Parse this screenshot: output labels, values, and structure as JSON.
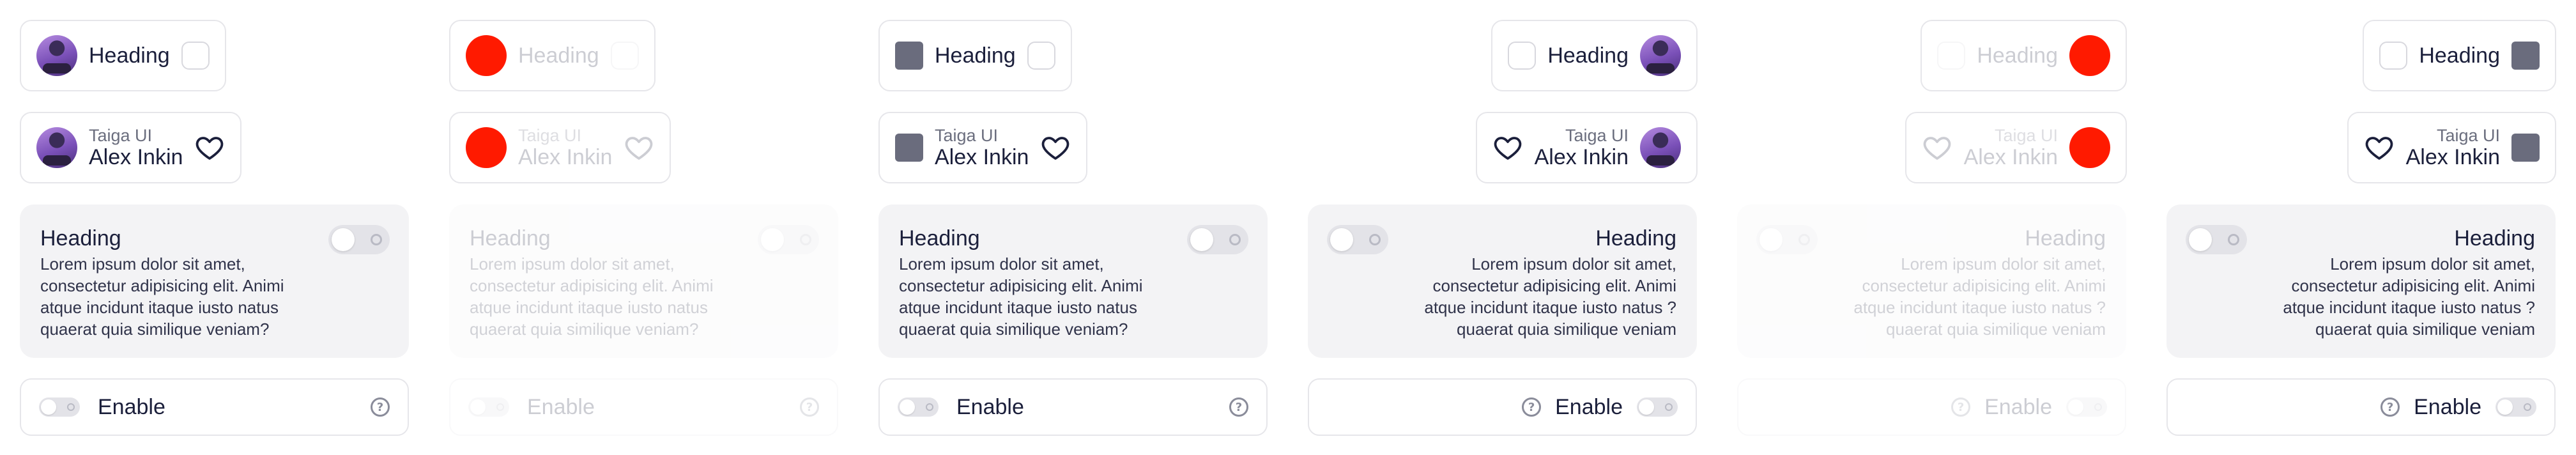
{
  "text": {
    "heading": "Heading",
    "caption": "Taiga UI",
    "name": "Alex Inkin",
    "card_heading": "Heading",
    "card_body": "Lorem ipsum dolor sit amet, consectetur adipisicing elit. Animi atque incidunt itaque iusto natus quaerat quia similique veniam?",
    "card_body_rtl": "Lorem ipsum dolor sit amet, consectetur adipisicing elit. Animi atque incidunt itaque iusto natus ?quaerat quia similique veniam",
    "enable_label": "Enable"
  },
  "icons": {
    "favorite": "heart-icon",
    "help": "question-circle-icon",
    "help_glyph": "?"
  },
  "colors": {
    "avatar_placeholder_red": "#ff1a00",
    "square_leading": "#6a6c7d",
    "card_background": "#f3f3f5",
    "toggle_off": "#e3e3e8"
  }
}
